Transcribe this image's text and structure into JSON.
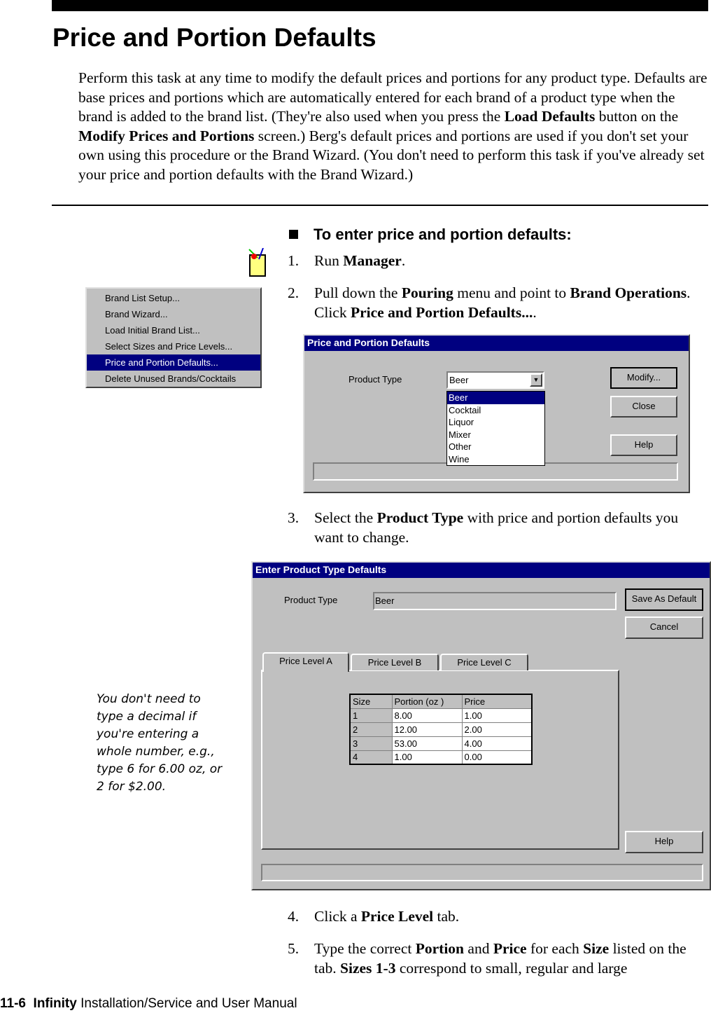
{
  "page": {
    "title": "Price and Portion Defaults",
    "intro": [
      {
        "t": "Perform this task at any time to modify the default prices and portions for any product type. Defaults are base prices and portions which are automatically entered for each brand of a product type when the brand is added to the brand list. (They're also used when you press the "
      },
      {
        "b": "Load Defaults"
      },
      {
        "t": " button on the "
      },
      {
        "b": "Modify Prices and Portions"
      },
      {
        "t": " screen.) Berg's default prices and portions are used if you don't set your own using this procedure or the Brand Wizard. (You don't need to perform this task if you've already set your price and portion defaults with the Brand Wizard.)"
      }
    ],
    "procedure_heading": "To enter price and portion defaults:",
    "steps": [
      {
        "n": "1.",
        "parts": [
          {
            "t": "Run "
          },
          {
            "b": "Manager"
          },
          {
            "t": "."
          }
        ]
      },
      {
        "n": "2.",
        "parts": [
          {
            "t": "Pull down the "
          },
          {
            "b": "Pouring"
          },
          {
            "t": " menu and point to "
          },
          {
            "b": "Brand Operations"
          },
          {
            "t": ". Click "
          },
          {
            "b": "Price and Portion Defaults..."
          },
          {
            "t": "."
          }
        ]
      },
      {
        "n": "3.",
        "parts": [
          {
            "t": "Select the "
          },
          {
            "b": "Product Type"
          },
          {
            "t": " with price and portion defaults you want to change."
          }
        ]
      },
      {
        "n": "4.",
        "parts": [
          {
            "t": "Click a "
          },
          {
            "b": "Price Level"
          },
          {
            "t": " tab."
          }
        ]
      },
      {
        "n": "5.",
        "parts": [
          {
            "t": "Type the correct "
          },
          {
            "b": "Portion"
          },
          {
            "t": " and "
          },
          {
            "b": "Price"
          },
          {
            "t": " for each "
          },
          {
            "b": "Size"
          },
          {
            "t": " listed on the tab. "
          },
          {
            "b": "Sizes 1-3"
          },
          {
            "t": " correspond to small, regular and large"
          }
        ]
      }
    ],
    "side_note": "You don't need to type a decimal if you're entering a whole number, e.g., type 6 for 6.00 oz, or 2 for $2.00.",
    "footer": {
      "page": "11-6",
      "product": "Infinity",
      "rest": "Installation/Service and User Manual"
    }
  },
  "menu": {
    "items": [
      "Brand List Setup...",
      "Brand Wizard...",
      "Load Initial Brand List...",
      "Select Sizes and Price Levels...",
      "Price and Portion Defaults...",
      "Delete Unused Brands/Cocktails"
    ],
    "selected": 4
  },
  "dialog1": {
    "title": "Price and Portion Defaults",
    "label": "Product Type",
    "value": "Beer",
    "options": [
      "Beer",
      "Cocktail",
      "Liquor",
      "Mixer",
      "Other",
      "Wine"
    ],
    "buttons": [
      "Modify...",
      "Close",
      "Help"
    ]
  },
  "dialog2": {
    "title": "Enter Product Type Defaults",
    "label": "Product Type",
    "value": "Beer",
    "buttons": [
      "Save As Default",
      "Cancel",
      "Help"
    ],
    "tabs": [
      "Price Level A",
      "Price Level B",
      "Price Level C"
    ],
    "table": {
      "headers": [
        "Size",
        "Portion (oz )",
        "Price"
      ],
      "rows": [
        [
          "1",
          "8.00",
          "1.00"
        ],
        [
          "2",
          "12.00",
          "2.00"
        ],
        [
          "3",
          "53.00",
          "4.00"
        ],
        [
          "4",
          "1.00",
          "0.00"
        ]
      ]
    }
  },
  "colors": {
    "titlebar": "#000080",
    "window": "#c0c0c0"
  }
}
